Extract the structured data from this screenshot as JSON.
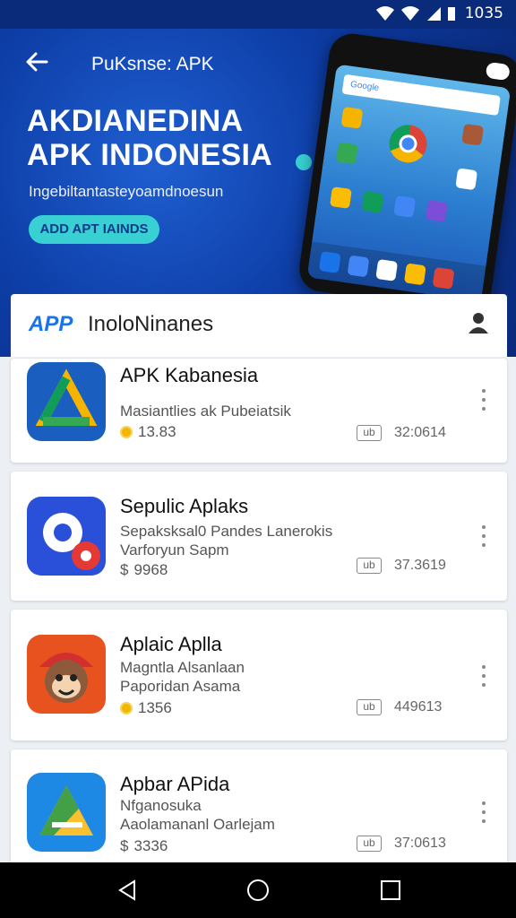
{
  "status_bar": {
    "time": "1035"
  },
  "hero": {
    "top_title": "PuKsnse: APK",
    "heading_line1": "AKDIANEDINA",
    "heading_line2": "APK INDONESIA",
    "subtitle": "Ingebiltantasteyoamdnoesun",
    "cta_label": "ADD APT IAINDS",
    "phone_search": "Google"
  },
  "list_header": {
    "brand": "APP",
    "title": "InoloNinanes"
  },
  "apps": [
    {
      "name": "APK Kabanesia",
      "desc_line1": "Masiantlies ak Pubeiatsik",
      "desc_line2": "",
      "rating": "13.83",
      "size_badge": "ub",
      "size": "32:0614",
      "icon": "drive-style-icon"
    },
    {
      "name": "Sepulic Aplaks",
      "desc_line1": "Sepaksksal0 Pandes Lanerokis",
      "desc_line2": "Varforyun Sapm",
      "rating": "9968",
      "size_badge": "ub",
      "size": "37.3619",
      "icon": "music-target-icon"
    },
    {
      "name": "Aplaic Aplla",
      "desc_line1": "Magntla Alsanlaan",
      "desc_line2": "Paporidan Asama",
      "rating": "1356",
      "size_badge": "ub",
      "size": "449613",
      "icon": "monkey-icon"
    },
    {
      "name": "Apbar APida",
      "desc_line1": "Nfganosuka",
      "desc_line2": "Aaolamananl Oarlejam",
      "rating": "3336",
      "size_badge": "ub",
      "size": "37:0613",
      "icon": "triangle-logo-icon"
    }
  ],
  "colors": {
    "primary": "#0d3da6",
    "accent": "#38d0d2",
    "brand": "#1a73e8"
  }
}
